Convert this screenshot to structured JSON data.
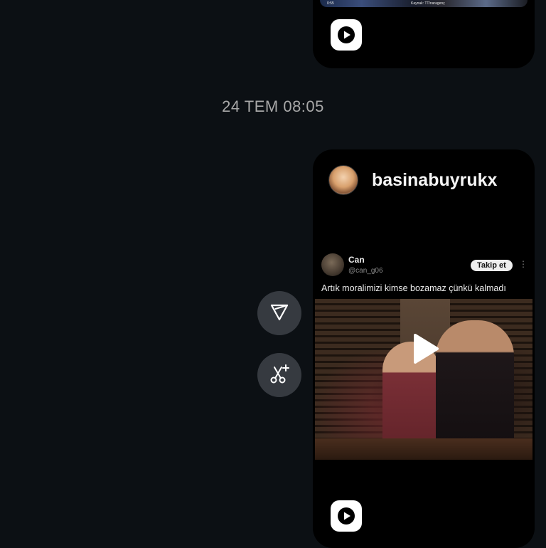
{
  "previous_message": {
    "thumb_time": "0:55",
    "thumb_caption": "Kaynak: TT/naragenç",
    "play_icon": "reel-play-icon"
  },
  "timestamp": "24 TEM 08:05",
  "reel": {
    "username": "basinabuyrukx",
    "tweet": {
      "name": "Can",
      "handle": "@can_g06",
      "follow_label": "Takip et",
      "more": "⋮",
      "text": "Artık moralimizi kimse bozamaz çünkü kalmadı"
    },
    "play_icon": "reel-play-icon"
  },
  "side_actions": {
    "share_icon": "send-icon",
    "ai_icon": "ai-sparkle-scissors-icon"
  },
  "colors": {
    "background": "#0c1014",
    "card": "#000000",
    "side_button": "#363a40",
    "timestamp": "#a8a8a8"
  }
}
